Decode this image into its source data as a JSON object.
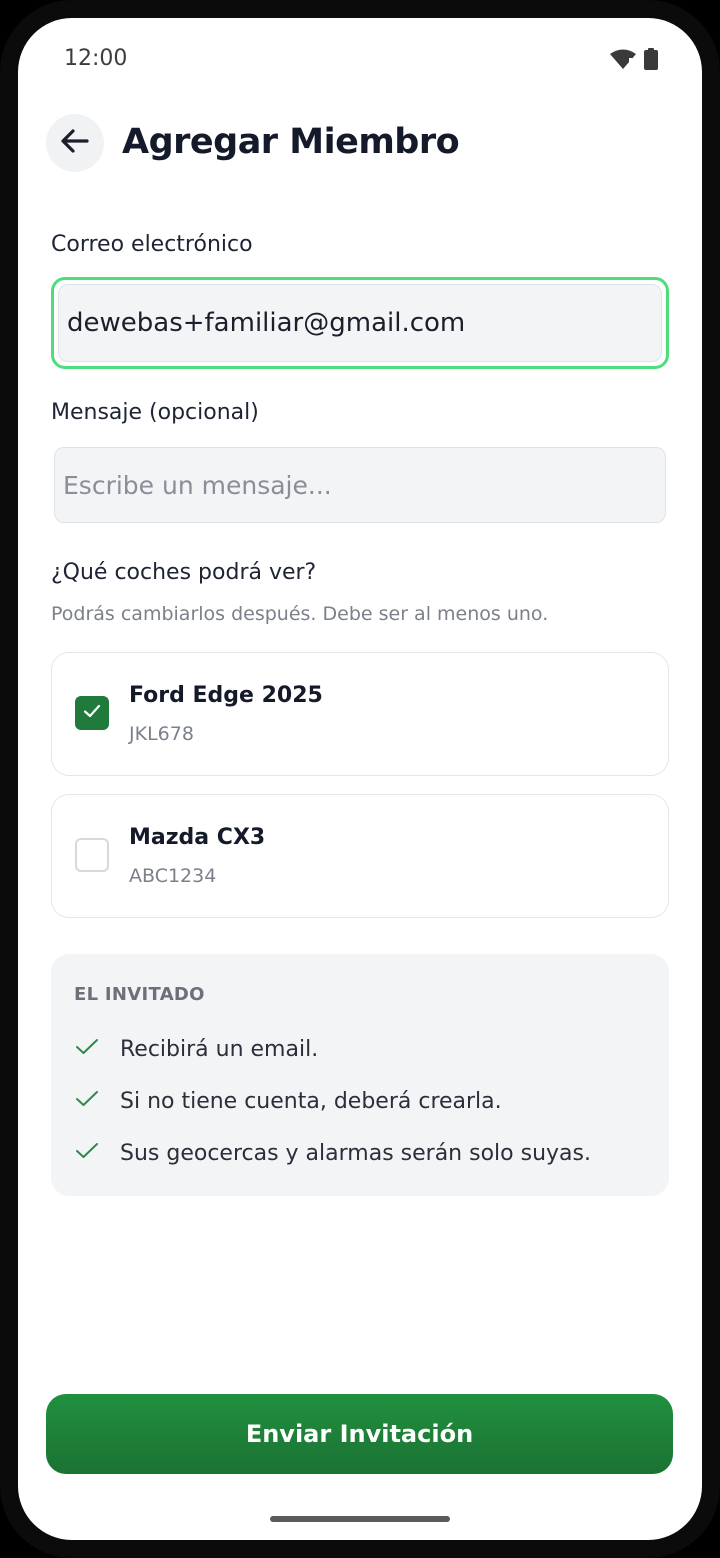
{
  "status_bar": {
    "time": "12:00"
  },
  "header": {
    "title": "Agregar Miembro"
  },
  "form": {
    "email_label": "Correo electrónico",
    "email_value": "dewebas+familiar@gmail.com",
    "message_label": "Mensaje (opcional)",
    "message_placeholder": "Escribe un mensaje...",
    "cars_question": "¿Qué coches podrá ver?",
    "cars_hint": "Podrás cambiarlos después. Debe ser al menos uno."
  },
  "cars": [
    {
      "name": "Ford Edge 2025",
      "plate": "JKL678",
      "checked": true
    },
    {
      "name": "Mazda CX3",
      "plate": "ABC1234",
      "checked": false
    }
  ],
  "info": {
    "title": "EL INVITADO",
    "items": [
      "Recibirá un email.",
      "Si no tiene cuenta, deberá crearla.",
      "Sus geocercas y alarmas serán solo suyas."
    ]
  },
  "actions": {
    "send_label": "Enviar Invitación"
  },
  "colors": {
    "accent": "#1f7a3c",
    "focus_border": "#4fdd7c"
  }
}
